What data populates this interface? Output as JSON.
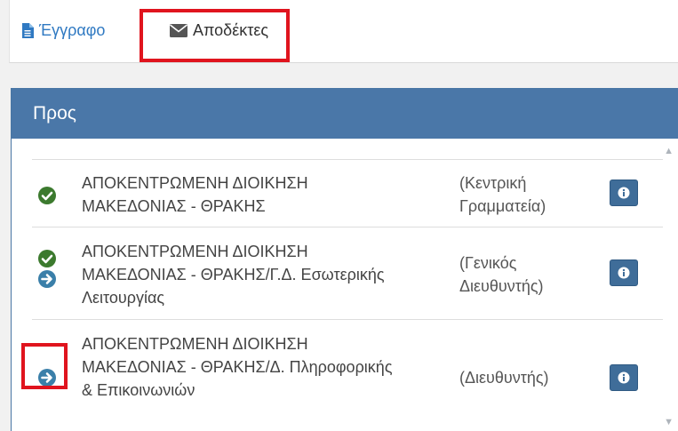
{
  "tabs": {
    "document": "Έγγραφο",
    "recipients": "Αποδέκτες"
  },
  "panel": {
    "title": "Προς",
    "rows": [
      {
        "line1": "ΑΠΟΚΕΝΤΡΩΜΕΝΗ ΔΙΟΙΚΗΣΗ",
        "line2": "ΜΑΚΕΔΟΝΙΑΣ - ΘΡΑΚΗΣ",
        "role1": "(Κεντρική",
        "role2": "Γραμματεία)",
        "icons": [
          "check-circle-icon"
        ]
      },
      {
        "line1": "ΑΠΟΚΕΝΤΡΩΜΕΝΗ ΔΙΟΙΚΗΣΗ",
        "line2": "ΜΑΚΕΔΟΝΙΑΣ - ΘΡΑΚΗΣ/Γ.Δ. Εσωτερικής",
        "line3": "Λειτουργίας",
        "role1": "(Γενικός",
        "role2": "Διευθυντής)",
        "icons": [
          "check-circle-icon",
          "arrow-right-circle-icon"
        ]
      },
      {
        "line1": "ΑΠΟΚΕΝΤΡΩΜΕΝΗ ΔΙΟΙΚΗΣΗ",
        "line2": "ΜΑΚΕΔΟΝΙΑΣ - ΘΡΑΚΗΣ/Δ. Πληροφορικής",
        "line3": "& Επικοινωνιών",
        "role1": "(Διευθυντής)",
        "icons": [
          "arrow-right-circle-icon"
        ]
      }
    ]
  },
  "colors": {
    "header_blue": "#4a77a8",
    "highlight_red": "#e0141e",
    "check_green": "#3c7a2e",
    "arrow_blue": "#3a7fa9",
    "link_blue": "#2f79c2"
  }
}
